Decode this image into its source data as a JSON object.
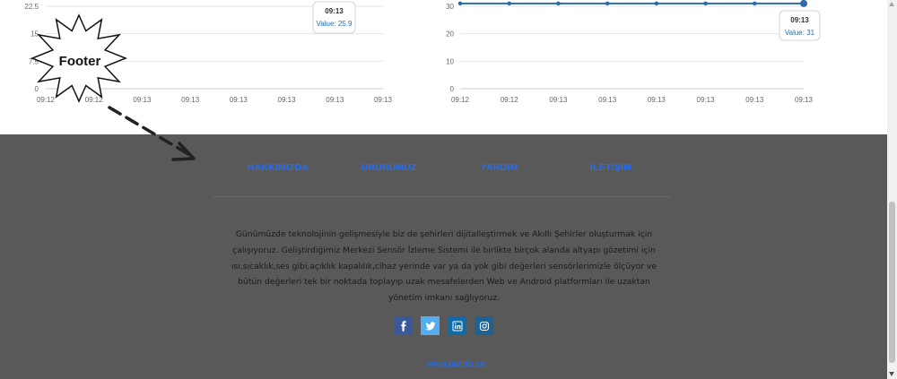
{
  "chart_data": [
    {
      "type": "line",
      "x": [
        "09:12",
        "09:12",
        "09:13",
        "09:13",
        "09:13",
        "09:13",
        "09:13",
        "09:13"
      ],
      "y_ticks": [
        "0",
        "7.5",
        "15",
        "22.5"
      ],
      "ylim": [
        0,
        22.5
      ],
      "series": [
        {
          "values": [
            null,
            null,
            null,
            null,
            null,
            null,
            null,
            null
          ]
        }
      ],
      "tooltip": {
        "time": "09:13",
        "value_label": "Value: 25.9"
      },
      "line_color": "#2b6da8",
      "grid": true
    },
    {
      "type": "line",
      "x": [
        "09:12",
        "09:12",
        "09:13",
        "09:13",
        "09:13",
        "09:13",
        "09:13",
        "09:13"
      ],
      "y_ticks": [
        "0",
        "10",
        "20",
        "30"
      ],
      "ylim": [
        0,
        30
      ],
      "series": [
        {
          "values": [
            31,
            31,
            31,
            31,
            31,
            31,
            31,
            31
          ]
        }
      ],
      "tooltip": {
        "time": "09:13",
        "value_label": "Value: 31"
      },
      "line_color": "#2b6da8",
      "grid": true
    }
  ],
  "footer": {
    "nav": [
      {
        "label": "HAKKIMIZDA"
      },
      {
        "label": "ÜRÜNÜMÜZ"
      },
      {
        "label": "YARDIM"
      },
      {
        "label": "İLETİŞİM"
      }
    ],
    "lines": [
      "Günümüzde teknolojinin gelişmesiyle biz de şehirleri dijitalleştirmek ve Akıllı Şehirler oluşturmak için",
      "çalışıyoruz. Geliştirdiğimiz Merkezi Sensör İzleme Sistemi ile birlikte birçok alanda altyapı gözetimi için",
      "ısı,sıcaklık,ses gibi,açıklık kapalılık,cihaz yerinde var ya da yok gibi değerleri sensörlerimizle ölçüyor ve",
      "bütün değerleri tek bir noktada toplayıp uzak mesafelerden Web ve Android platformları ile uzaktan",
      "yönetim imkanı sağlıyoruz."
    ],
    "social": [
      {
        "icon": "facebook-icon",
        "color": "#3b5998"
      },
      {
        "icon": "twitter-icon",
        "color": "#55acee"
      },
      {
        "icon": "linkedin-icon",
        "color": "#0e6aa8"
      },
      {
        "icon": "instagram-icon",
        "color": "#1f6191"
      }
    ],
    "site": "www.parlab.co"
  },
  "annotation": {
    "label": "Footer"
  }
}
